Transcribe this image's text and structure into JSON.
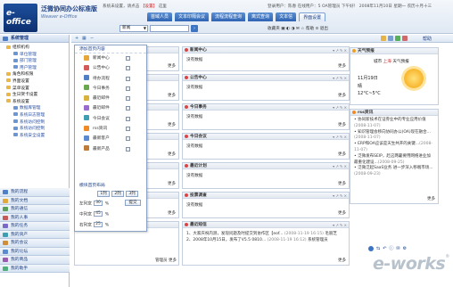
{
  "header": {
    "logo_mark": "e-office",
    "brand": "泛微协同办公标准版",
    "brand_sub": "Weaver e-Office",
    "message_prefix": "系统未设置，请点击",
    "message_link": "【设置】",
    "message_suffix": "这里",
    "status": "登录用户：陈春  在线用户：5  OA管理员  下午好！  2008年11月10日 星期一 农历十月十三",
    "tabs": [
      "首域人员",
      "文本印隔会议",
      "流程流程查询",
      "离式查询",
      "文本信",
      "界面设置"
    ],
    "active_tab": 5,
    "select_value": "新闻",
    "right_links": "收藏夹  ▣  ◐  ◑  ✉  ☆  帮助  ⊙  退出"
  },
  "sidebar": {
    "title": "系统管理",
    "tree": [
      {
        "label": "组织机构",
        "level": 1,
        "type": "folder"
      },
      {
        "label": "单位管理",
        "level": 2,
        "type": "leaf"
      },
      {
        "label": "部门管理",
        "level": 2,
        "type": "leaf"
      },
      {
        "label": "用户管理",
        "level": 2,
        "type": "leaf"
      },
      {
        "label": "角色和权限",
        "level": 1,
        "type": "folder"
      },
      {
        "label": "界面设置",
        "level": 1,
        "type": "folder"
      },
      {
        "label": "菜单设置",
        "level": 1,
        "type": "folder"
      },
      {
        "label": "生日贺卡设置",
        "level": 1,
        "type": "folder"
      },
      {
        "label": "系统设置",
        "level": 1,
        "type": "folder"
      },
      {
        "label": "数据库管理",
        "level": 2,
        "type": "leaf"
      },
      {
        "label": "系统日志管理",
        "level": 2,
        "type": "leaf"
      },
      {
        "label": "系统访问控制",
        "level": 2,
        "type": "leaf"
      },
      {
        "label": "系统访问控制",
        "level": 2,
        "type": "leaf"
      },
      {
        "label": "系统安全设置",
        "level": 2,
        "type": "leaf"
      }
    ],
    "menu": [
      "我的流程",
      "我的文档",
      "我的通信",
      "我的人事",
      "我的任务",
      "我的资产",
      "我的会议",
      "我的论坛",
      "我的商品",
      "我的助手"
    ]
  },
  "subbar": {
    "help_label": "帮助"
  },
  "add_panel": {
    "title": "添加首页内容",
    "items": [
      "新闻中心",
      "公告中心",
      "待办流程",
      "今日事务",
      "最近邮件",
      "最近邮件",
      "今日会议",
      "rss资讯",
      "最新客户",
      "最新产品"
    ],
    "layout_title": "模块首页布局",
    "layout_buttons": [
      "1列",
      "2列",
      "3列"
    ],
    "left_label": "左列宽",
    "left_value": "30",
    "mid_label": "中列宽",
    "mid_value": "45",
    "right_label": "右列宽",
    "right_value": "25",
    "percent": "%",
    "submit": "提交"
  },
  "col1": [
    {
      "title": "",
      "body": "",
      "more": "更多"
    },
    {
      "title": "",
      "body": "",
      "more": "更多"
    },
    {
      "title": "",
      "body": "",
      "more": "更多"
    },
    {
      "title": "",
      "body": "",
      "more": "更多"
    },
    {
      "title": "",
      "body": "",
      "more": "更多"
    },
    {
      "title": "",
      "body": "",
      "more": "更多"
    },
    {
      "title": "",
      "body": "",
      "more": ""
    }
  ],
  "col1_more_last": "管理员  更多",
  "col2": [
    {
      "title": "新闻中心",
      "body": "没有数据",
      "more": "更多"
    },
    {
      "title": "公告中心",
      "body": "没有数据",
      "more": "更多"
    },
    {
      "title": "今日事务",
      "body": "没有数据",
      "more": "更多"
    },
    {
      "title": "今日会议",
      "body": "没有数据",
      "more": "更多"
    },
    {
      "title": "最近计划",
      "body": "没有数据",
      "more": "更多"
    },
    {
      "title": "投票调查",
      "body": "没有数据",
      "more": "更多"
    }
  ],
  "dispatch": {
    "title": "最近短信",
    "lines": [
      {
        "text": "1、大家庆祝内测，发现问题及时提交到协作区【eof...",
        "date": "(2008-11-19 16:15)",
        "tail": "毛丽芝"
      },
      {
        "text": "2、2008年10月15日，发布了V5.5 0810...",
        "date": "(2008-11-19 16:12)",
        "tail": "系统管理员"
      }
    ],
    "more": "更多"
  },
  "weather": {
    "title": "天气预报",
    "city_label": "城市",
    "city": "上海",
    "forecast_label": "天气预报",
    "date": "11月19日",
    "desc": "晴",
    "temp": "12°C~5°C"
  },
  "rss": {
    "title": "rss资讯",
    "items": [
      {
        "text": "• 协同新技术在证券业中的专业应用价值",
        "date": "(2008-11-07)"
      },
      {
        "text": "• 知识管理会移向协同办公(OA)现在融合...",
        "date": "(2008-11-07)"
      },
      {
        "text": "• ERP和OA应该是天生共开的关键...",
        "date": "(2008-11-07)"
      },
      {
        "text": "• 泛微发布SEIP，赶这两暑要用网络进业加最重化建设...",
        "date": "(2008-09-25)"
      },
      {
        "text": "• 泛微泛起SaaS业务 进一步深入移端市场...",
        "date": "(2008-09-23)"
      }
    ],
    "more": "更多"
  },
  "watermark": "e-works"
}
